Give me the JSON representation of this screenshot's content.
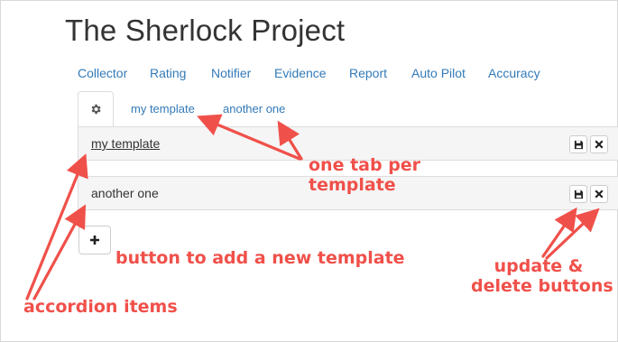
{
  "app": {
    "title": "The Sherlock Project"
  },
  "nav": {
    "items": [
      "Collector",
      "Rating",
      "Notifier",
      "Evidence",
      "Report",
      "Auto Pilot",
      "Accuracy"
    ]
  },
  "tabs": {
    "settings_icon": "gear-icon",
    "items": [
      "my template",
      "another one"
    ]
  },
  "accordion": {
    "items": [
      {
        "label": "my template",
        "save_icon": "floppy-disk-icon",
        "delete_icon": "close-icon"
      },
      {
        "label": "another one",
        "save_icon": "floppy-disk-icon",
        "delete_icon": "close-icon"
      }
    ]
  },
  "add_button": {
    "icon": "plus-icon"
  },
  "annotations": {
    "tab_per_template": [
      "one tab per",
      "template"
    ],
    "add_template": "button to add a new template",
    "update_delete": [
      "update &",
      "delete buttons"
    ],
    "accordion_items": "accordion items",
    "color": "#f0504a"
  },
  "colors": {
    "link": "#337ab7",
    "panel_bg": "#f5f5f5",
    "border": "#dddddd"
  }
}
